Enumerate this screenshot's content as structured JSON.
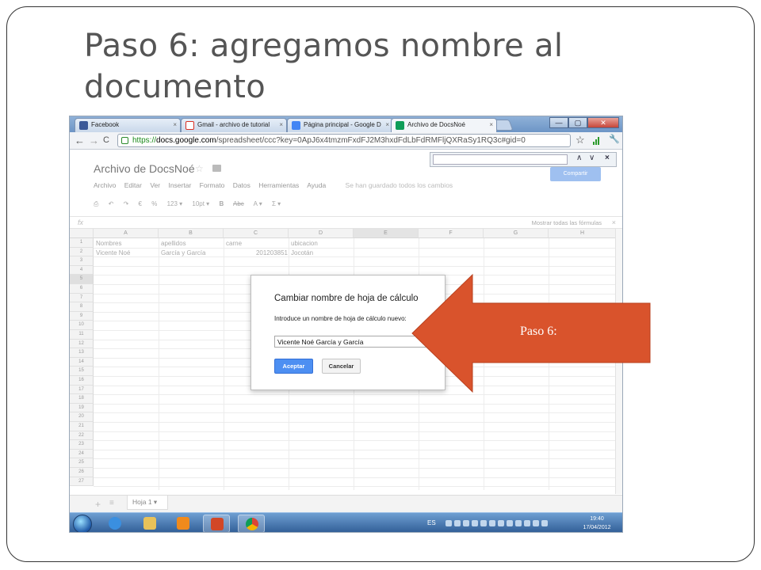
{
  "slide": {
    "title": "Paso 6: agregamos nombre al documento"
  },
  "browser": {
    "tabs": [
      {
        "label": "Facebook",
        "close": "×",
        "icon_color": "#3b5998"
      },
      {
        "label": "Gmail - archivo de tutorial",
        "close": "×",
        "icon_color": "#d93025"
      },
      {
        "label": "Página principal - Google D",
        "close": "×",
        "icon_color": "#4285f4"
      },
      {
        "label": "Archivo de DocsNoé",
        "close": "×",
        "icon_color": "#0f9d58"
      }
    ],
    "window_buttons": {
      "minimize": "—",
      "maximize": "▢",
      "close": "✕"
    },
    "url": {
      "scheme": "https://",
      "host": "docs.google.com",
      "path": "/spreadsheet/ccc?key=0ApJ6x4tmzmFxdFJ2M3hxdFdLbFdRMFljQXRaSy1RQ3c#gid=0"
    },
    "nav": {
      "back": "←",
      "forward": "→",
      "reload": "C",
      "star": "☆",
      "wrench": "🔧"
    }
  },
  "findbar": {
    "up": "∧",
    "down": "∨",
    "close": "×"
  },
  "docs": {
    "doc_title": "Archivo de DocsNoé",
    "star": "☆",
    "share_label": "Compartir",
    "menu": [
      "Archivo",
      "Editar",
      "Ver",
      "Insertar",
      "Formato",
      "Datos",
      "Herramientas",
      "Ayuda"
    ],
    "save_status": "Se han guardado todos los cambios",
    "format_bar": [
      "⎙",
      "↶",
      "↷",
      "€",
      "%",
      "123 ▾",
      "10pt ▾",
      "B",
      "Abc",
      "A ▾",
      "Σ ▾"
    ],
    "fx": "fx",
    "show_formulas": "Mostrar todas las fórmulas",
    "fx_close": "×",
    "columns": [
      "A",
      "B",
      "C",
      "D",
      "E",
      "F",
      "G",
      "H"
    ],
    "rows": [
      "1",
      "2",
      "3",
      "4",
      "5",
      "6",
      "7",
      "8",
      "9",
      "10",
      "11",
      "12",
      "13",
      "14",
      "15",
      "16",
      "17",
      "18",
      "19",
      "20",
      "21",
      "22",
      "23",
      "24",
      "25",
      "26",
      "27"
    ],
    "cells": {
      "a1": "Nombres",
      "b1": "apellidos",
      "c1": "carne",
      "d1": "ubicacion",
      "a2": "Vicente Noé",
      "b2": "García y García",
      "c2": "201203851",
      "d2": "Jocotán"
    },
    "sheet": {
      "add": "+",
      "list": "≡",
      "tab": "Hoja 1 ▾"
    }
  },
  "dialog": {
    "title": "Cambiar nombre de hoja de cálculo",
    "prompt": "Introduce un nombre de hoja de cálculo nuevo:",
    "input_value": "Vicente Noé García y García",
    "ok_label": "Aceptar",
    "cancel_label": "Cancelar"
  },
  "taskbar": {
    "lang": "ES",
    "time": "19:40",
    "date": "17/04/2012",
    "apps": [
      {
        "name": "ie",
        "color": "#3a8fe0"
      },
      {
        "name": "explorer",
        "color": "#e8c25a"
      },
      {
        "name": "media",
        "color": "#f08a1c"
      },
      {
        "name": "powerpoint",
        "color": "#d24726"
      },
      {
        "name": "chrome",
        "color": "#4caf50"
      }
    ]
  },
  "callout": {
    "label": "Paso 6:",
    "color": "#d9532c"
  }
}
